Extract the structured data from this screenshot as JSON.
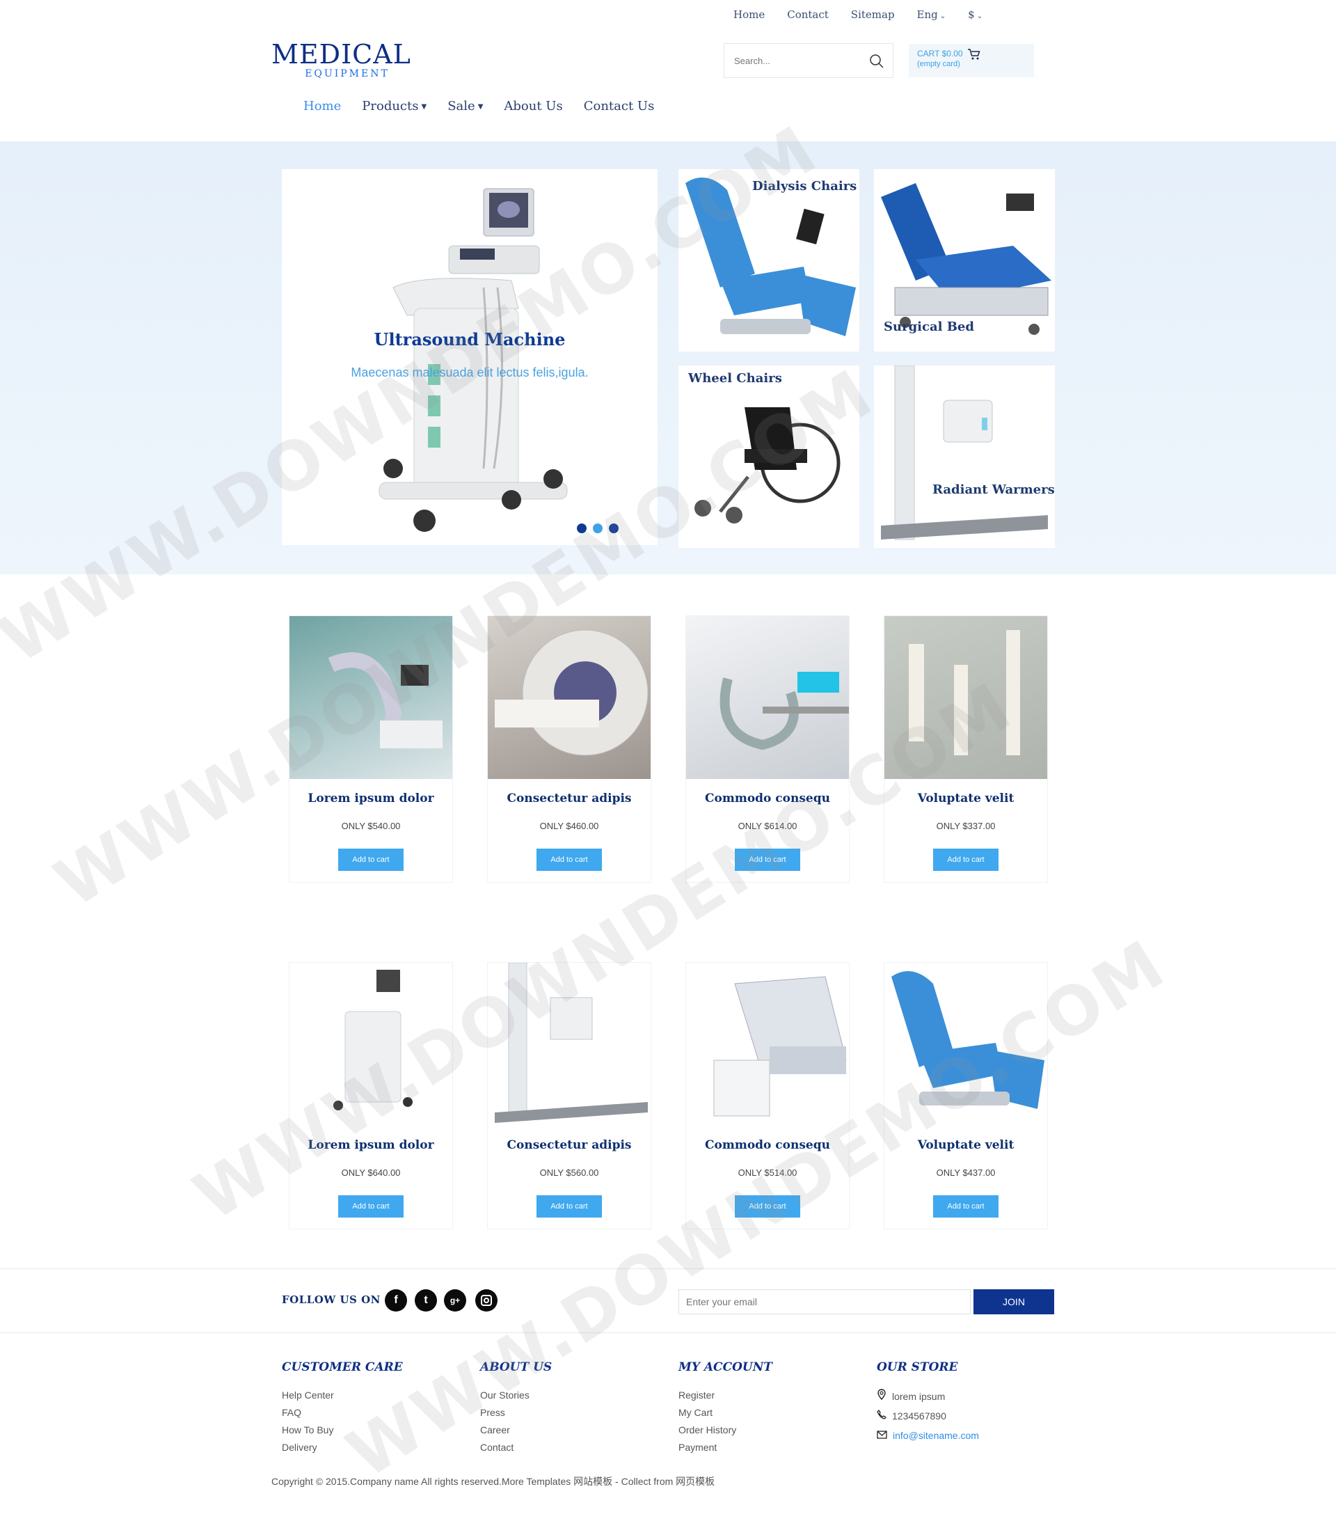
{
  "top_links": {
    "home": "Home",
    "contact": "Contact",
    "sitemap": "Sitemap",
    "lang": "Eng",
    "currency": "$"
  },
  "logo": {
    "main": "MEDICAL",
    "sub": "EQUIPMENT"
  },
  "search": {
    "placeholder": "Search..."
  },
  "cart": {
    "line1": "CART $0.00",
    "line2": "(empty card)"
  },
  "nav": {
    "home": "Home",
    "products": "Products",
    "sale": "Sale",
    "about": "About Us",
    "contact": "Contact Us"
  },
  "hero": {
    "title": "Ultrasound Machine",
    "subtitle": "Maecenas malesuada elit lectus felis,igula.",
    "tiles": [
      "Dialysis Chairs",
      "Surgical Bed",
      "Wheel Chairs",
      "Radiant Warmers"
    ]
  },
  "products": [
    {
      "name": "Lorem ipsum dolor",
      "price": "ONLY $540.00",
      "button": "Add to cart"
    },
    {
      "name": "Consectetur adipis",
      "price": "ONLY $460.00",
      "button": "Add to cart"
    },
    {
      "name": "Commodo consequ",
      "price": "ONLY $614.00",
      "button": "Add to cart"
    },
    {
      "name": "Voluptate velit",
      "price": "ONLY $337.00",
      "button": "Add to cart"
    },
    {
      "name": "Lorem ipsum dolor",
      "price": "ONLY $640.00",
      "button": "Add to cart"
    },
    {
      "name": "Consectetur adipis",
      "price": "ONLY $560.00",
      "button": "Add to cart"
    },
    {
      "name": "Commodo consequ",
      "price": "ONLY $514.00",
      "button": "Add to cart"
    },
    {
      "name": "Voluptate velit",
      "price": "ONLY $437.00",
      "button": "Add to cart"
    }
  ],
  "follow": {
    "label": "FOLLOW US ON",
    "email_placeholder": "Enter your email",
    "join": "JOIN"
  },
  "footer": {
    "customer_care": {
      "title": "CUSTOMER CARE",
      "links": [
        "Help Center",
        "FAQ",
        "How To Buy",
        "Delivery"
      ]
    },
    "about_us": {
      "title": "ABOUT US",
      "links": [
        "Our Stories",
        "Press",
        "Career",
        "Contact"
      ]
    },
    "my_account": {
      "title": "MY ACCOUNT",
      "links": [
        "Register",
        "My Cart",
        "Order History",
        "Payment"
      ]
    },
    "our_store": {
      "title": "OUR STORE",
      "address": "lorem ipsum",
      "phone": "1234567890",
      "email": "info@sitename.com"
    }
  },
  "copyright": "Copyright © 2015.Company name All rights reserved.More Templates 网站模板 - Collect from 网页模板",
  "watermark": "WWW.DOWNDEMO.COM",
  "colors": {
    "brand_navy": "#0e2f86",
    "accent_blue": "#3fa8ef",
    "hero_bg": "#e6f0fa"
  }
}
